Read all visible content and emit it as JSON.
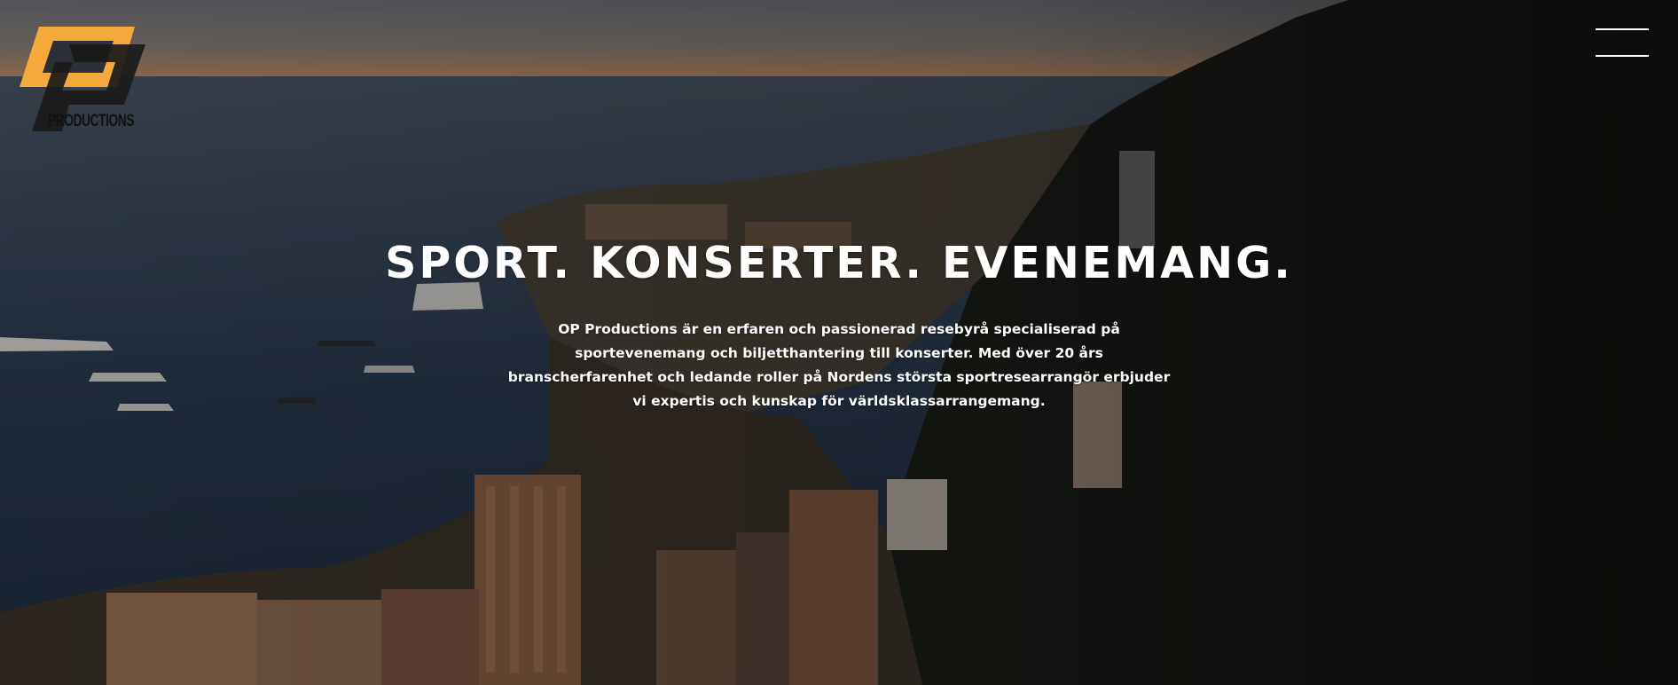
{
  "header": {
    "logo": {
      "brand_text": "PRODUCTIONS",
      "accent_color": "#F5A93B",
      "dark_color": "#1A1A1A",
      "icon": "op-productions-logo"
    },
    "menu_button": {
      "icon": "hamburger-menu-icon"
    }
  },
  "hero": {
    "background": "aerial-coastal-city-at-dusk",
    "headline": "SPORT. KONSERTER. EVENEMANG.",
    "intro": "OP Productions är en erfaren och passionerad resebyrå specialiserad på sportevenemang och biljetthantering till konserter. Med över 20 års branscherfarenhet och ledande roller på Nordens största sportresearrangör erbjuder vi expertis och kunskap för världsklassarrangemang."
  }
}
